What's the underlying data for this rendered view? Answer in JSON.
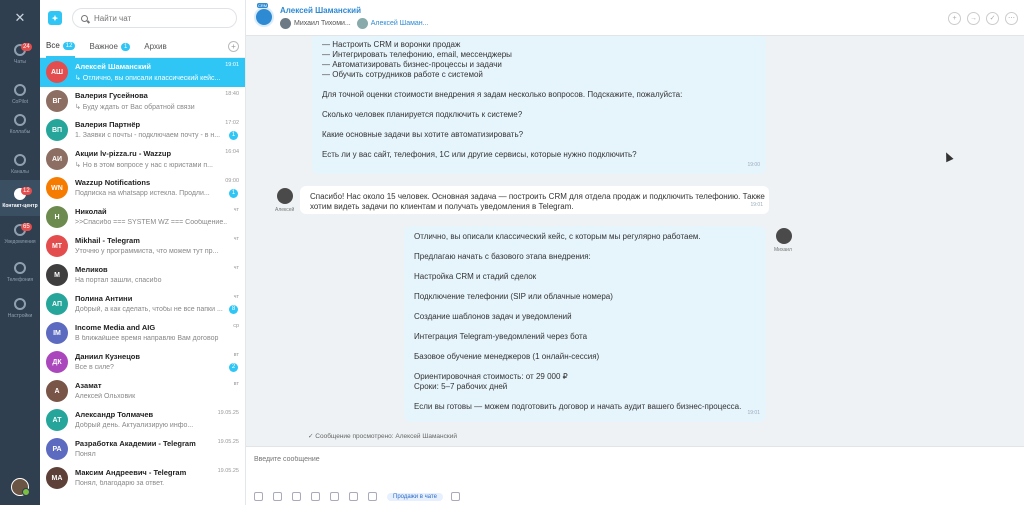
{
  "rail": {
    "items": [
      {
        "label": "Чаты",
        "badge": "24"
      },
      {
        "label": "CoPilot",
        "badge": ""
      },
      {
        "label": "Коллабы",
        "badge": ""
      },
      {
        "label": "Каналы",
        "badge": ""
      },
      {
        "label": "Контакт-центр",
        "badge": "12"
      },
      {
        "label": "Уведомления",
        "badge": "65"
      },
      {
        "label": "Телефония",
        "badge": ""
      },
      {
        "label": "Настройки",
        "badge": ""
      }
    ]
  },
  "search": {
    "placeholder": "Найти чат"
  },
  "tabs": [
    {
      "label": "Все",
      "count": "12"
    },
    {
      "label": "Важное",
      "count": "1"
    },
    {
      "label": "Архив",
      "count": ""
    }
  ],
  "chats": [
    {
      "initials": "АШ",
      "color": "#e44d4d",
      "name": "Алексей Шаманский",
      "msg": "↳ Отлично, вы описали классический кейс...",
      "time": "19:01",
      "badge": ""
    },
    {
      "initials": "ВГ",
      "color": "#8d6e63",
      "name": "Валерия Гусейнова",
      "msg": "↳ Буду ждать от Вас обратной связи",
      "time": "18:40",
      "badge": ""
    },
    {
      "initials": "ВП",
      "color": "#26a69a",
      "name": "Валерия Партнёр",
      "msg": "1. Заявки с почты - подключаем почту - в н...",
      "time": "17:02",
      "badge": "1"
    },
    {
      "initials": "АИ",
      "color": "#8d6e63",
      "name": "Акции lv-pizza.ru - Wazzup",
      "msg": "↳ Но в этом вопросе у нас с юристами п...",
      "time": "16:04",
      "badge": ""
    },
    {
      "initials": "WN",
      "color": "#f57c00",
      "name": "Wazzup Notifications",
      "msg": "Подписка на whatsapp истекла. Продли...",
      "time": "09:00",
      "badge": "1"
    },
    {
      "initials": "Н",
      "color": "#6d8b4f",
      "name": "Николай",
      "msg": ">>Спасибо === SYSTEM WZ === Сообщение...",
      "time": "чт",
      "badge": ""
    },
    {
      "initials": "MT",
      "color": "#e44d4d",
      "name": "Mikhail - Telegram",
      "msg": "Уточню у программиста, что можем тут пр...",
      "time": "чт",
      "badge": ""
    },
    {
      "initials": "М",
      "color": "#3e3e3e",
      "name": "Меликов",
      "msg": "На портал зашли, спасибо",
      "time": "чт",
      "badge": ""
    },
    {
      "initials": "АП",
      "color": "#26a69a",
      "name": "Полина Антини",
      "msg": "Добрый, а как сделать, чтобы не все папки ...",
      "time": "чт",
      "badge": "8"
    },
    {
      "initials": "IM",
      "color": "#5c6bc0",
      "name": "Income Media and AIG",
      "msg": "В ближайшее время направлю Вам договор",
      "time": "ср",
      "badge": ""
    },
    {
      "initials": "ДК",
      "color": "#ab47bc",
      "name": "Даниил Кузнецов",
      "msg": "Все в силе?",
      "time": "вт",
      "badge": "2"
    },
    {
      "initials": "А",
      "color": "#795548",
      "name": "Азамат",
      "msg": "Алексей Ольховик",
      "time": "вт",
      "badge": ""
    },
    {
      "initials": "АТ",
      "color": "#26a69a",
      "name": "Александр Толмачев",
      "msg": "Добрый день. Актуализирую инфо...",
      "time": "19.05.25",
      "badge": ""
    },
    {
      "initials": "РА",
      "color": "#5c6bc0",
      "name": "Разработка Академии - Telegram",
      "msg": "Понял",
      "time": "19.05.25",
      "badge": ""
    },
    {
      "initials": "МА",
      "color": "#5d4037",
      "name": "Максим Андреевич - Telegram",
      "msg": "Понял, благодарю за ответ.",
      "time": "19.05.25",
      "badge": ""
    }
  ],
  "header": {
    "title": "Алексей Шаманский",
    "operator": "Михаил Тихоми...",
    "client": "Алексей Шаман..."
  },
  "messages": [
    {
      "text": "— Настроить CRM и воронки продаж\n— Интегрировать телефонию, email, мессенджеры\n— Автоматизировать бизнес-процессы и задачи\n— Обучить сотрудников работе с системой\n\nДля точной оценки стоимости внедрения я задам несколько вопросов. Подскажите, пожалуйста:\n\nСколько человек планируется подключить к системе?\n\nКакие основные задачи вы хотите автоматизировать?\n\nЕсть ли у вас сайт, телефония, 1С или другие сервисы, которые нужно подключить?",
      "time": "19:00"
    },
    {
      "text": "Спасибо! Нас около 15 человек. Основная задача — построить CRM для отдела продаж и подключить телефонию. Также\nхотим видеть задачи по клиентам и получать уведомления в Telegram.",
      "time": "19:01",
      "author": "Алексей"
    },
    {
      "text": "Отлично, вы описали классический кейс, с которым мы регулярно работаем.\n\nПредлагаю начать с базового этапа внедрения:\n\nНастройка CRM и стадий сделок\n\nПодключение телефонии (SIP или облачные номера)\n\nСоздание шаблонов задач и уведомлений\n\nИнтеграция Telegram-уведомлений через бота\n\nБазовое обучение менеджеров (1 онлайн-сессия)\n\nОриентировочная стоимость: от 29 000 ₽\nСроки: 5–7 рабочих дней\n\nЕсли вы готовы — можем подготовить договор и начать аудит вашего бизнес-процесса.",
      "time": "19:01",
      "author": "Михаил"
    }
  ],
  "seen": "Сообщение просмотрено: Алексей Шаманский",
  "compose": {
    "placeholder": "Введите сообщение",
    "sales_label": "Продажи в чате"
  }
}
